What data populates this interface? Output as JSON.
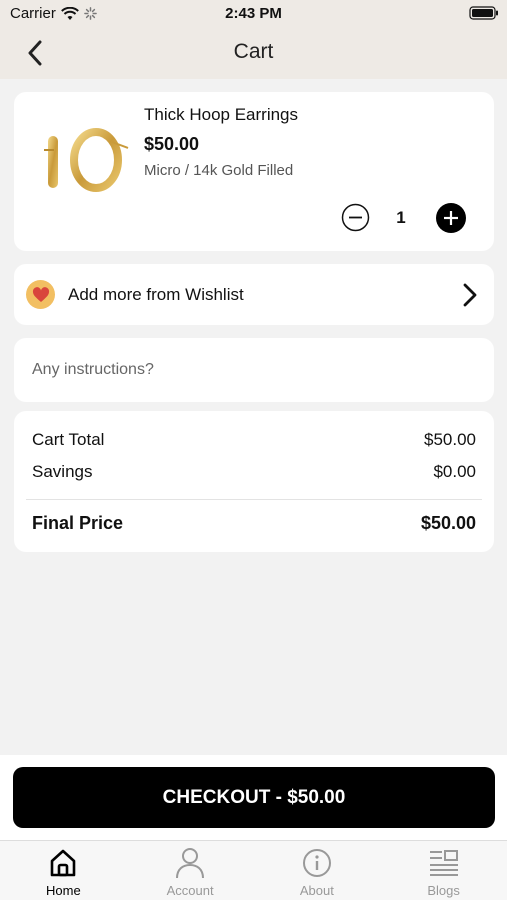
{
  "status_bar": {
    "carrier": "Carrier",
    "time": "2:43 PM"
  },
  "header": {
    "title": "Cart"
  },
  "cart_item": {
    "name": "Thick Hoop Earrings",
    "price": "$50.00",
    "variant": "Micro / 14k Gold Filled",
    "quantity": "1"
  },
  "wishlist": {
    "label": "Add more from Wishlist"
  },
  "instructions": {
    "placeholder": "Any instructions?",
    "value": ""
  },
  "summary": {
    "cart_total_label": "Cart Total",
    "cart_total_value": "$50.00",
    "savings_label": "Savings",
    "savings_value": "$0.00",
    "final_price_label": "Final Price",
    "final_price_value": "$50.00"
  },
  "checkout": {
    "label": "CHECKOUT - $50.00"
  },
  "tabs": [
    {
      "label": "Home",
      "icon": "home-icon",
      "active": true
    },
    {
      "label": "Account",
      "icon": "account-icon",
      "active": false
    },
    {
      "label": "About",
      "icon": "info-icon",
      "active": false
    },
    {
      "label": "Blogs",
      "icon": "blogs-icon",
      "active": false
    }
  ],
  "colors": {
    "accent": "#000000",
    "header_bg": "#eeeae5",
    "heart_badge": "#f2bf62",
    "heart": "#d9453c"
  }
}
